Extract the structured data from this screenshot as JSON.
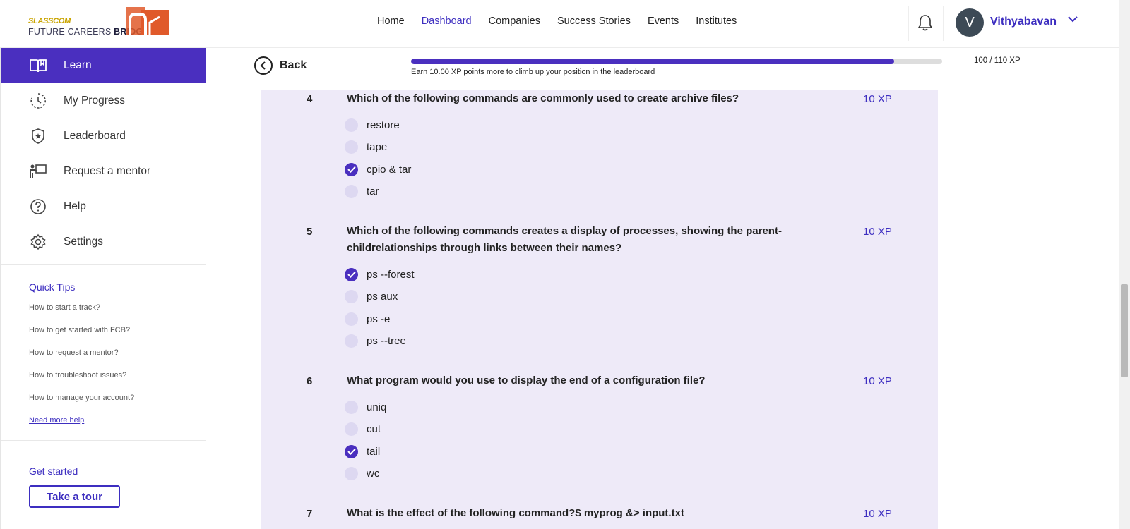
{
  "brand": {
    "top": "SLASSCOM",
    "bottom_light": "FUTURE CAREERS ",
    "bottom_bold": "BRIDGE"
  },
  "nav": [
    "Home",
    "Dashboard",
    "Companies",
    "Success Stories",
    "Events",
    "Institutes"
  ],
  "nav_active": "Dashboard",
  "user": {
    "initial": "V",
    "name": "Vithyabavan"
  },
  "sidebar": {
    "items": [
      {
        "label": "Learn",
        "icon": "book-icon",
        "active": true
      },
      {
        "label": "My Progress",
        "icon": "clock-icon"
      },
      {
        "label": "Leaderboard",
        "icon": "shield-star-icon"
      },
      {
        "label": "Request a mentor",
        "icon": "mentor-board-icon"
      },
      {
        "label": "Help",
        "icon": "help-icon"
      },
      {
        "label": "Settings",
        "icon": "gear-icon"
      }
    ],
    "tips_title": "Quick Tips",
    "tips": [
      "How to start a track?",
      "How to get started with FCB?",
      "How to request a mentor?",
      "How to troubleshoot issues?",
      "How to manage your account?"
    ],
    "need_help": "Need more help",
    "get_started": "Get started",
    "tour_button": "Take a tour"
  },
  "progress": {
    "back_label": "Back",
    "fill_fraction": 0.909,
    "note": "Earn 10.00 XP points more to climb up your position in the leaderboard",
    "xp_text": "100 / 110 XP"
  },
  "questions": [
    {
      "number": "4",
      "text": "Which of the following commands are commonly used to create archive files?",
      "xp": "10 XP",
      "options": [
        {
          "label": "restore",
          "checked": false
        },
        {
          "label": "tape",
          "checked": false
        },
        {
          "label": "cpio & tar",
          "checked": true
        },
        {
          "label": "tar",
          "checked": false
        }
      ]
    },
    {
      "number": "5",
      "text": "Which of the following commands creates a display of processes, showing the parent-childrelationships through links between their names?",
      "xp": "10 XP",
      "options": [
        {
          "label": "ps --forest",
          "checked": true
        },
        {
          "label": "ps aux",
          "checked": false
        },
        {
          "label": "ps -e",
          "checked": false
        },
        {
          "label": "ps --tree",
          "checked": false
        }
      ]
    },
    {
      "number": "6",
      "text": "What program would you use to display the end of a configuration file?",
      "xp": "10 XP",
      "options": [
        {
          "label": "uniq",
          "checked": false
        },
        {
          "label": "cut",
          "checked": false
        },
        {
          "label": "tail",
          "checked": true
        },
        {
          "label": "wc",
          "checked": false
        }
      ]
    },
    {
      "number": "7",
      "text": "What is the effect of the following command?$ myprog &> input.txt",
      "xp": "10 XP",
      "options": []
    }
  ],
  "colors": {
    "accent": "#4a2fbf",
    "panel": "#eeeaf8",
    "radio_unchecked": "#ddd8f1"
  }
}
